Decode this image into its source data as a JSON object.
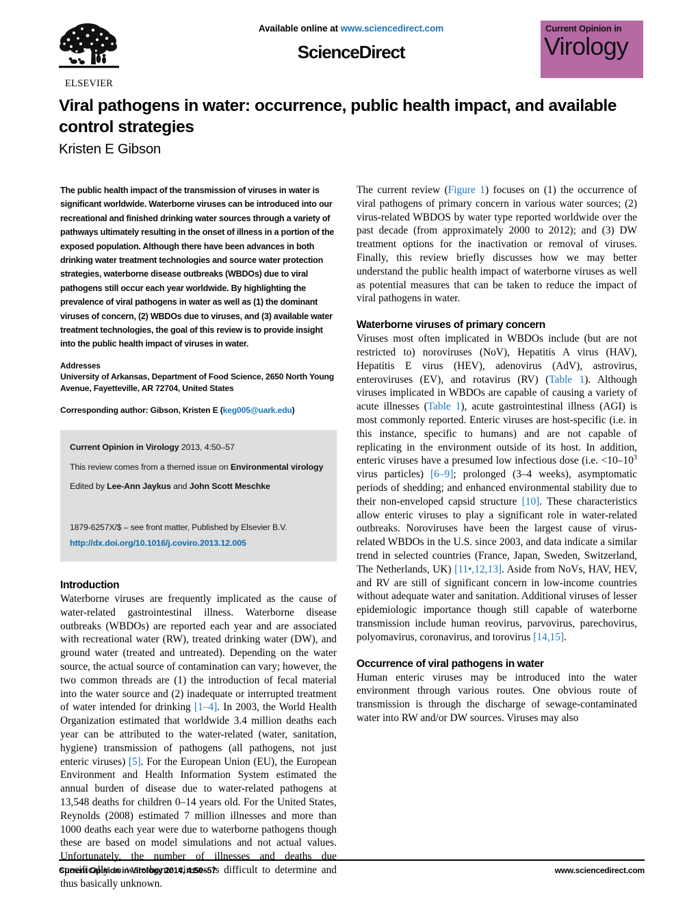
{
  "header": {
    "available_online": "Available online at ",
    "sciencedirect_url": "www.sciencedirect.com",
    "sciencedirect_wordmark": "ScienceDirect",
    "elsevier_wordmark": "ELSEVIER",
    "journal_badge_top": "Current Opinion in",
    "journal_badge_main": "Virology",
    "badge_color": "#b56aa4",
    "link_color": "#1a75bb"
  },
  "title": {
    "article_title": "Viral pathogens in water: occurrence, public health impact, and available control strategies",
    "authors": "Kristen E Gibson"
  },
  "abstract": {
    "text": "The public health impact of the transmission of viruses in water is significant worldwide. Waterborne viruses can be introduced into our recreational and finished drinking water sources through a variety of pathways ultimately resulting in the onset of illness in a portion of the exposed population. Although there have been advances in both drinking water treatment technologies and source water protection strategies, waterborne disease outbreaks (WBDOs) due to viral pathogens still occur each year worldwide. By highlighting the prevalence of viral pathogens in water as well as (1) the dominant viruses of concern, (2) WBDOs due to viruses, and (3) available water treatment technologies, the goal of this review is to provide insight into the public health impact of viruses in water."
  },
  "addresses": {
    "heading": "Addresses",
    "text": "University of Arkansas, Department of Food Science, 2650 North Young Avenue, Fayetteville, AR 72704, United States",
    "corresponding_prefix": "Corresponding author: Gibson, Kristen E (",
    "corresponding_email": "keg005@uark.edu",
    "corresponding_suffix": ")"
  },
  "info_box": {
    "citation_journal": "Current Opinion in Virology",
    "citation_rest": " 2013, 4:50–57",
    "themed_prefix": "This review comes from a themed issue on ",
    "themed_issue": "Environmental virology",
    "edited_prefix": "Edited by ",
    "editor_1": "Lee-Ann Jaykus",
    "edited_middle": " and ",
    "editor_2": "John Scott Meschke",
    "front_matter": "1879-6257X/$ – see front matter, Published by Elsevier B.V.",
    "doi": "http://dx.doi.org/10.1016/j.coviro.2013.12.005"
  },
  "sections": {
    "introduction": {
      "heading": "Introduction",
      "paragraph_1_a": "Waterborne viruses are frequently implicated as the cause of water-related gastrointestinal illness. Waterborne disease outbreaks (WBDOs) are reported each year and are associated with recreational water (RW), treated drinking water (DW), and ground water (treated and untreated). Depending on the water source, the actual source of contamination can vary; however, the two common threads are (1) the introduction of fecal material into the water source and (2) inadequate or interrupted treatment of water intended for drinking ",
      "ref_1_4": "[1–4]",
      "paragraph_1_b": ". In 2003, the World Health Organization estimated that worldwide 3.4 million deaths each year can be attributed to the water-related (water, sanitation, hygiene) transmission of pathogens (all pathogens, not just enteric viruses) ",
      "ref_5": "[5]",
      "paragraph_1_c": ". For the European Union (EU), the European Environment and Health Information System estimated the annual burden of disease due to water-related pathogens at 13,548 deaths for children 0–14 years old. For the United States, Reynolds (2008) estimated 7 million illnesses and more than 1000 deaths each year were due to waterborne pathogens though these are based on model simulations and not actual values. Unfortunately, the number of illnesses and deaths due specifically to waterborne viruses is difficult to determine and thus basically unknown.",
      "paragraph_2_a": "The current review (",
      "ref_figure_1": "Figure 1",
      "paragraph_2_b": ") focuses on (1) the occurrence of viral pathogens of primary concern in various water sources; (2) virus-related WBDOS by water type reported worldwide over the past decade (from approximately 2000 to 2012); and (3) DW treatment options for the inactivation or removal of viruses. Finally, this review briefly discusses how we may better understand the public health impact of waterborne viruses as well as potential measures that can be taken to reduce the impact of viral pathogens in water."
    },
    "waterborne_viruses": {
      "heading": "Waterborne viruses of primary concern",
      "p_a": "Viruses most often implicated in WBDOs include (but are not restricted to) noroviruses (NoV), Hepatitis A virus (HAV), Hepatitis E virus (HEV), adenovirus (AdV), astrovirus, enteroviruses (EV), and rotavirus (RV) (",
      "ref_table_1a": "Table 1",
      "p_b": "). Although viruses implicated in WBDOs are capable of causing a variety of acute illnesses (",
      "ref_table_1b": "Table 1",
      "p_c": "), acute gastrointestinal illness (AGI) is most commonly reported. Enteric viruses are host-specific (i.e. in this instance, specific to humans) and are not capable of replicating in the environment outside of its host. In addition, enteric viruses have a presumed low infectious dose (i.e. <10–10",
      "p_c_sup": "3",
      "p_d": " virus particles) ",
      "ref_6_9": "[6–9]",
      "p_e": "; prolonged (3–4 weeks), asymptomatic periods of shedding; and enhanced environmental stability due to their non-enveloped capsid structure ",
      "ref_10": "[10]",
      "p_f": ". These characteristics allow enteric viruses to play a significant role in water-related outbreaks. Noroviruses have been the largest cause of virus-related WBDOs in the U.S. since 2003, and data indicate a similar trend in selected countries (France, Japan, Sweden, Switzerland, The Netherlands, UK) ",
      "ref_11_13": "[11•,12,13]",
      "p_g": ". Aside from NoVs, HAV, HEV, and RV are still of significant concern in low-income countries without adequate water and sanitation. Additional viruses of lesser epidemiologic importance though still capable of waterborne transmission include human reovirus, parvovirus, parechovirus, polyomavirus, coronavirus, and torovirus ",
      "ref_14_15": "[14,15]",
      "p_h": "."
    },
    "occurrence": {
      "heading": "Occurrence of viral pathogens in water",
      "p_a": "Human enteric viruses may be introduced into the water environment through various routes. One obvious route of transmission is through the discharge of sewage-contaminated water into RW and/or DW sources. Viruses may also"
    }
  },
  "left_column_footer": {
    "journal": "Current Opinion in Virology",
    "citation": " 2014, 4:50–57"
  },
  "footer": {
    "journal": "Current Opinion in Virology",
    "citation": " 2014, 4:50–57",
    "url": "www.sciencedirect.com"
  }
}
